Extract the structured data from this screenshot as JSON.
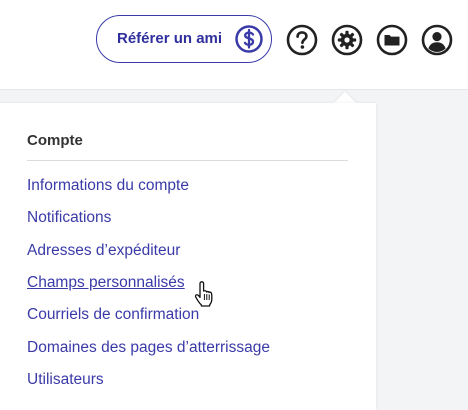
{
  "header": {
    "refer_button_label": "Référer un ami",
    "icons": [
      "dollar-icon",
      "help-icon",
      "settings-icon",
      "folder-icon",
      "account-icon"
    ]
  },
  "colors": {
    "accent": "#3a3aa8",
    "text": "#333333",
    "background": "#f3f4f6"
  },
  "menu": {
    "section_title": "Compte",
    "hovered_index": 3,
    "items": [
      {
        "label": "Informations du compte"
      },
      {
        "label": "Notifications"
      },
      {
        "label": "Adresses d’expéditeur"
      },
      {
        "label": "Champs personnalisés"
      },
      {
        "label": "Courriels de confirmation"
      },
      {
        "label": "Domaines des pages d’atterrissage"
      },
      {
        "label": "Utilisateurs"
      }
    ]
  }
}
